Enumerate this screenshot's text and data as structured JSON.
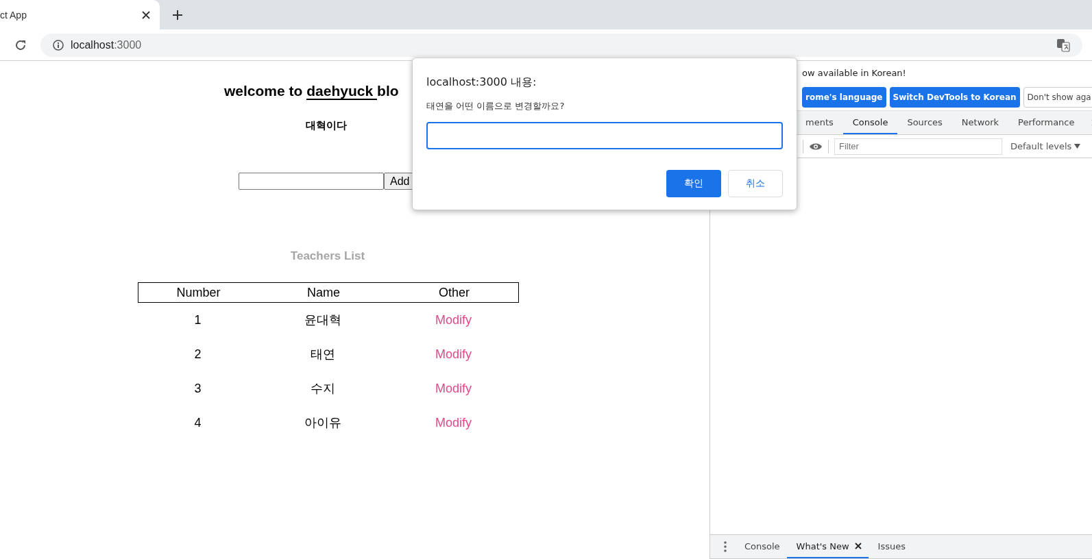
{
  "browser": {
    "tab": {
      "title": "ct App"
    },
    "address": {
      "host": "localhost",
      "port": ":3000"
    }
  },
  "page": {
    "heading": {
      "prefix": "welcome to",
      "link": "daehyuck",
      "suffix": "blo"
    },
    "subtitle": "대혁이다",
    "add_button": "Add",
    "list_title": "Teachers List",
    "table": {
      "columns": [
        "Number",
        "Name",
        "Other"
      ],
      "rows": [
        {
          "number": "1",
          "name": "윤대혁",
          "action": "Modify"
        },
        {
          "number": "2",
          "name": "태연",
          "action": "Modify"
        },
        {
          "number": "3",
          "name": "수지",
          "action": "Modify"
        },
        {
          "number": "4",
          "name": "아이유",
          "action": "Modify"
        }
      ]
    }
  },
  "dialog": {
    "title": "localhost:3000 내용:",
    "message": "태연을 어떤 이름으로 변경할까요?",
    "buttons": [
      {
        "label": "확인",
        "kind": "primary"
      },
      {
        "label": "취소",
        "kind": "secondary"
      }
    ]
  },
  "devtools": {
    "infobar": {
      "message": "ow available in Korean!",
      "buttons": [
        {
          "label": "rome's language",
          "kind": "primary"
        },
        {
          "label": "Switch DevTools to Korean",
          "kind": "primary"
        },
        {
          "label": "Don't show aga",
          "kind": "plain"
        }
      ]
    },
    "tabs": [
      {
        "label": "ments",
        "selected": false
      },
      {
        "label": "Console",
        "selected": true
      },
      {
        "label": "Sources",
        "selected": false
      },
      {
        "label": "Network",
        "selected": false
      },
      {
        "label": "Performance",
        "selected": false
      }
    ],
    "filter": {
      "placeholder": "Filter"
    },
    "levels": "Default levels",
    "drawer_tabs": [
      {
        "label": "Console",
        "selected": false,
        "closable": false
      },
      {
        "label": "What's New",
        "selected": true,
        "closable": true
      },
      {
        "label": "Issues",
        "selected": false,
        "closable": false
      }
    ]
  }
}
